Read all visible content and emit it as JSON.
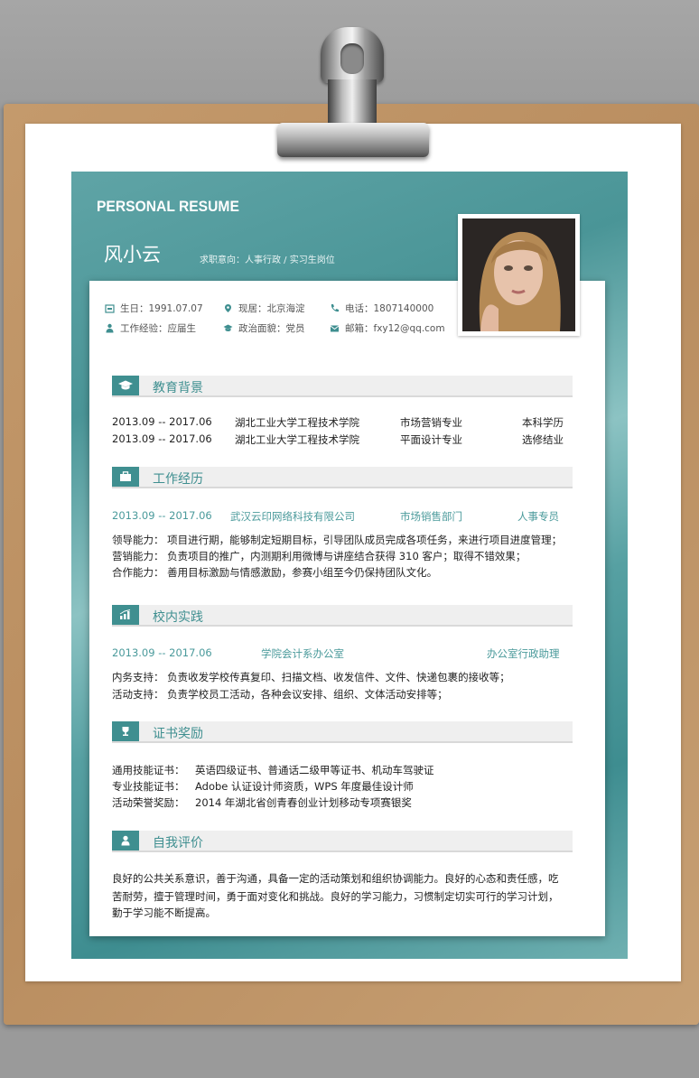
{
  "header": {
    "title_en": "PERSONAL RESUME",
    "name": "风小云",
    "intent": "求职意向：人事行政 / 实习生岗位"
  },
  "info": {
    "birthday": "生日：1991.07.07",
    "residence": "现居：北京海淀",
    "phone": "电话：1807140000",
    "experience": "工作经验：应届生",
    "politics": "政治面貌：党员",
    "email": "邮箱：fxy12@qq.com"
  },
  "sections": {
    "education": "教育背景",
    "work": "工作经历",
    "campus": "校内实践",
    "awards": "证书奖励",
    "self": "自我评价"
  },
  "education": [
    {
      "period": "2013.09 -- 2017.06",
      "school": "湖北工业大学工程技术学院",
      "major": "市场营销专业",
      "degree": "本科学历"
    },
    {
      "period": "2013.09 -- 2017.06",
      "school": "湖北工业大学工程技术学院",
      "major": "平面设计专业",
      "degree": "选修结业"
    }
  ],
  "work": {
    "period": "2013.09 -- 2017.06",
    "company": "武汉云印网络科技有限公司",
    "dept": "市场销售部门",
    "role": "人事专员",
    "lines": [
      "领导能力：   项目进行期，能够制定短期目标，引导团队成员完成各项任务，来进行项目进度管理；",
      "营销能力：   负责项目的推广，内测期利用微博与讲座结合获得 310 客户；取得不错效果；",
      "合作能力：   善用目标激励与情感激励，参赛小组至今仍保持团队文化。"
    ]
  },
  "campus": {
    "period": "2013.09 -- 2017.06",
    "org": "学院会计系办公室",
    "role": "办公室行政助理",
    "lines": [
      "内务支持：   负责收发学校传真复印、扫描文档、收发信件、文件、快递包裹的接收等；",
      "活动支持：   负责学校员工活动，各种会议安排、组织、文体活动安排等；"
    ]
  },
  "awards": {
    "lines": [
      {
        "label": "通用技能证书：",
        "value": "英语四级证书、普通话二级甲等证书、机动车驾驶证"
      },
      {
        "label": "专业技能证书：",
        "value": "Adobe 认证设计师资质，WPS 年度最佳设计师"
      },
      {
        "label": "活动荣誉奖励：",
        "value": "2014 年湖北省创青春创业计划移动专项赛银奖"
      }
    ]
  },
  "self_eval": {
    "lines": [
      "良好的公共关系意识，善于沟通，具备一定的活动策划和组织协调能力。良好的心态和责任感，吃",
      "苦耐劳，擅于管理时间，勇于面对变化和挑战。良好的学习能力，习惯制定切实可行的学习计划，",
      "勤于学习能不断提高。"
    ]
  },
  "colors": {
    "accent": "#3f8f90",
    "teal_text": "#4a9a9b",
    "board": "#c49a6c"
  }
}
